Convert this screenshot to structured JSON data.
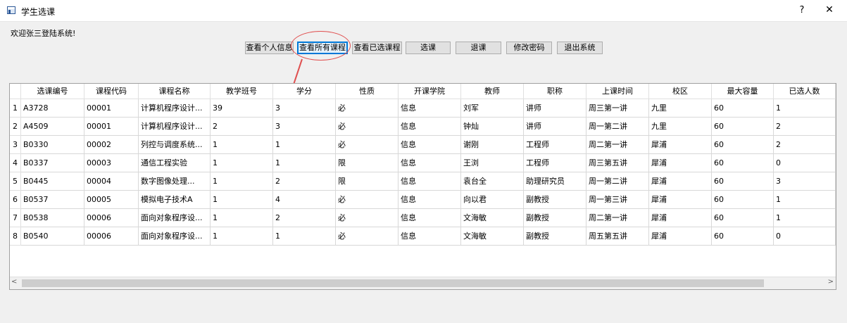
{
  "window": {
    "title": "学生选课",
    "help": "?",
    "close": "✕"
  },
  "welcome": "欢迎张三登陆系统!",
  "toolbar": [
    {
      "label": "查看个人信息",
      "active": false
    },
    {
      "label": "查看所有课程",
      "active": true
    },
    {
      "label": "查看已选课程",
      "active": false
    },
    {
      "label": "选课",
      "active": false
    },
    {
      "label": "退课",
      "active": false
    },
    {
      "label": "修改密码",
      "active": false
    },
    {
      "label": "退出系统",
      "active": false
    }
  ],
  "table": {
    "columns": [
      "选课编号",
      "课程代码",
      "课程名称",
      "教学班号",
      "学分",
      "性质",
      "开课学院",
      "教师",
      "职称",
      "上课时间",
      "校区",
      "最大容量",
      "已选人数"
    ],
    "rows": [
      {
        "num": "1",
        "cells": [
          "A3728",
          "00001",
          "计算机程序设计...",
          "39",
          "3",
          "必",
          "信息",
          "刘军",
          "讲师",
          "周三第一讲",
          "九里",
          "60",
          "1"
        ]
      },
      {
        "num": "2",
        "cells": [
          "A4509",
          "00001",
          "计算机程序设计...",
          "2",
          "3",
          "必",
          "信息",
          "钟灿",
          "讲师",
          "周一第二讲",
          "九里",
          "60",
          "2"
        ]
      },
      {
        "num": "3",
        "cells": [
          "B0330",
          "00002",
          "列控与调度系统...",
          "1",
          "1",
          "必",
          "信息",
          "谢刚",
          "工程师",
          "周二第一讲",
          "犀浦",
          "60",
          "2"
        ]
      },
      {
        "num": "4",
        "cells": [
          "B0337",
          "00003",
          "通信工程实验",
          "1",
          "1",
          "限",
          "信息",
          "王浏",
          "工程师",
          "周三第五讲",
          "犀浦",
          "60",
          "0"
        ]
      },
      {
        "num": "5",
        "cells": [
          "B0445",
          "00004",
          "数字图像处理...",
          "1",
          "2",
          "限",
          "信息",
          "袁台全",
          "助理研究员",
          "周一第二讲",
          "犀浦",
          "60",
          "3"
        ]
      },
      {
        "num": "6",
        "cells": [
          "B0537",
          "00005",
          "模拟电子技术A",
          "1",
          "4",
          "必",
          "信息",
          "向以君",
          "副教授",
          "周一第三讲",
          "犀浦",
          "60",
          "1"
        ]
      },
      {
        "num": "7",
        "cells": [
          "B0538",
          "00006",
          "面向对象程序设...",
          "1",
          "2",
          "必",
          "信息",
          "文海敏",
          "副教授",
          "周二第一讲",
          "犀浦",
          "60",
          "1"
        ]
      },
      {
        "num": "8",
        "cells": [
          "B0540",
          "00006",
          "面向对象程序设...",
          "1",
          "1",
          "必",
          "信息",
          "文海敏",
          "副教授",
          "周五第五讲",
          "犀浦",
          "60",
          "0"
        ]
      }
    ]
  },
  "scrollbar": {
    "left_arrow": "<",
    "right_arrow": ">"
  },
  "annotation_color": "#e05050"
}
